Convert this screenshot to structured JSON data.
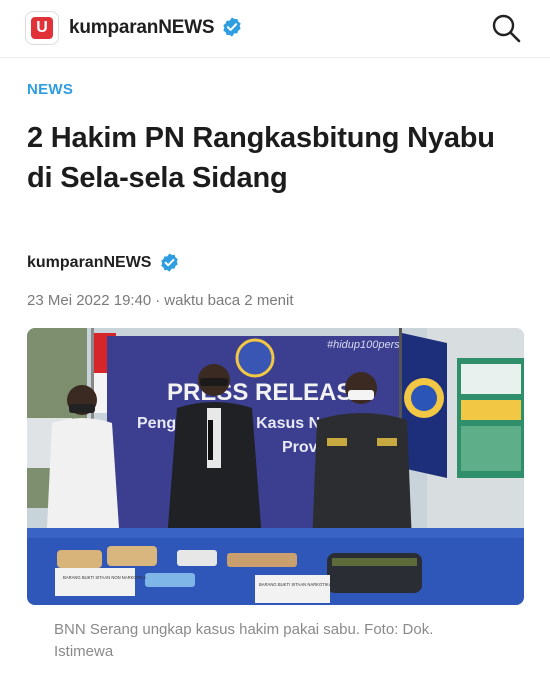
{
  "header": {
    "logo_letter": "U",
    "brand": "kumparanNEWS",
    "icons": [
      "verified-badge-icon",
      "search-icon"
    ],
    "brand_color": "#e13239",
    "verified_color": "#2f9ee0"
  },
  "article": {
    "category": "NEWS",
    "headline": "2 Hakim PN Rangkasbitung Nyabu di Sela-sela Sidang",
    "author": "kumparanNEWS",
    "date": "23 Mei 2022 19:40",
    "reading_time": "waktu baca 2 menit",
    "image": {
      "banner_text_1": "PRESS RELEASE",
      "banner_text_2": "Pengungkapan Kasus Narkotika",
      "banner_text_3": "Provinsi",
      "hashtag": "#hidup100persen",
      "sign_1": "BARANG BUKTI SITAAN NON NARKOTIKA",
      "sign_2": "BARANG BUKTI SITAAN NARKOTIKA"
    },
    "caption": "BNN Serang ungkap kasus hakim pakai sabu. Foto: Dok. Istimewa"
  }
}
